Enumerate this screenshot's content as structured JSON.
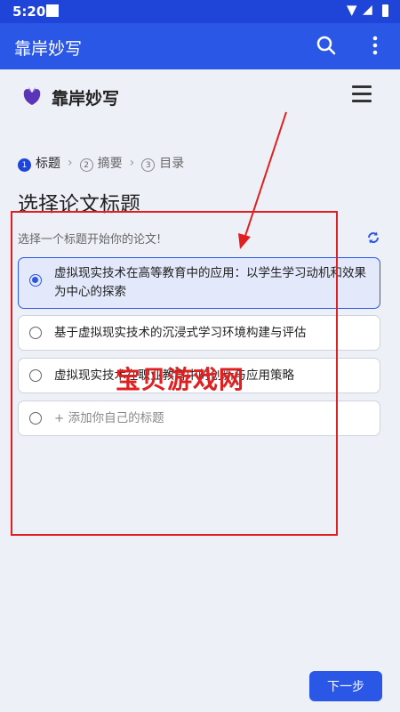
{
  "status_bar": {
    "time": "5:20"
  },
  "app_bar": {
    "title": "靠岸妙写"
  },
  "header": {
    "brand": "靠岸妙写"
  },
  "steps": [
    {
      "num": "1",
      "label": "标题"
    },
    {
      "num": "2",
      "label": "摘要"
    },
    {
      "num": "3",
      "label": "目录"
    }
  ],
  "main": {
    "title": "选择论文标题",
    "subtitle": "选择一个标题开始你的论文!",
    "options": [
      {
        "text": "虚拟现实技术在高等教育中的应用：以学生学习动机和效果为中心的探索",
        "selected": true
      },
      {
        "text": "基于虚拟现实技术的沉浸式学习环境构建与评估",
        "selected": false
      },
      {
        "text": "虚拟现实技术在职业教育中的创新与应用策略",
        "selected": false
      }
    ],
    "add_custom": "+ 添加你自己的标题"
  },
  "overlay": {
    "watermark": "宝贝游戏网"
  },
  "footer": {
    "next_label": "下一步"
  },
  "colors": {
    "primary": "#2b57e6",
    "annotation": "#e02020"
  }
}
